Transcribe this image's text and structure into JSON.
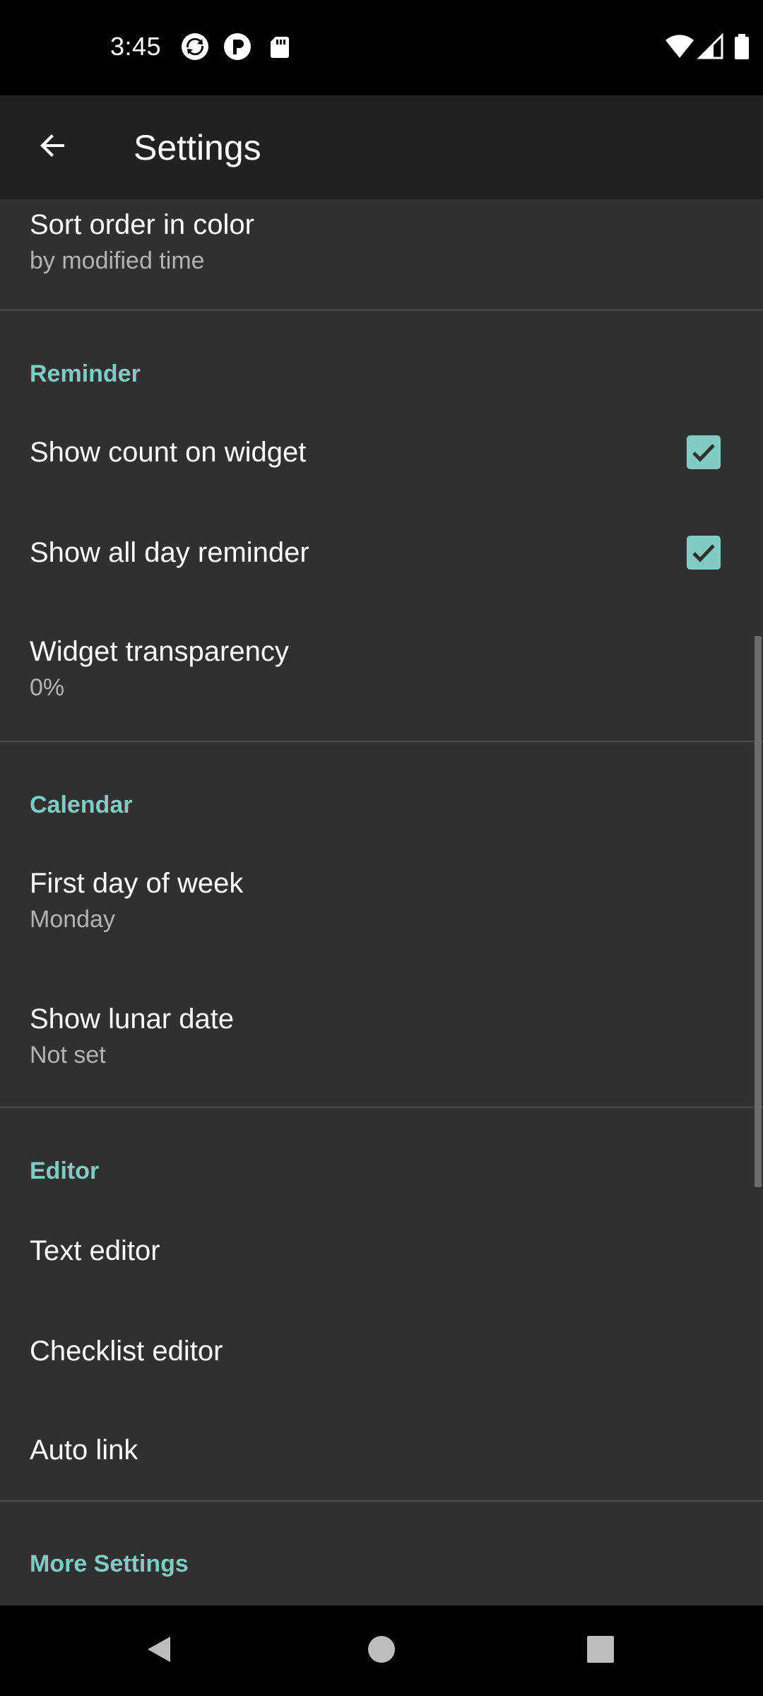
{
  "status_bar": {
    "time": "3:45",
    "left_icons": [
      "sync-icon",
      "p-badge-icon",
      "sd-card-icon"
    ],
    "right_icons": [
      "wifi-icon",
      "cell-signal-icon",
      "battery-icon"
    ]
  },
  "app_bar": {
    "title": "Settings",
    "back_icon": "arrow-back-icon"
  },
  "settings": {
    "sort_order": {
      "title": "Sort order in color",
      "summary": "by modified time"
    },
    "reminder": {
      "header": "Reminder",
      "show_count": {
        "title": "Show count on widget",
        "checked": true
      },
      "all_day": {
        "title": "Show all day reminder",
        "checked": true
      },
      "transparency": {
        "title": "Widget transparency",
        "summary": "0%"
      }
    },
    "calendar": {
      "header": "Calendar",
      "first_day": {
        "title": "First day of week",
        "summary": "Monday"
      },
      "lunar": {
        "title": "Show lunar date",
        "summary": "Not set"
      }
    },
    "editor": {
      "header": "Editor",
      "text_editor": {
        "title": "Text editor"
      },
      "checklist_editor": {
        "title": "Checklist editor"
      },
      "auto_link": {
        "title": "Auto link"
      }
    },
    "more": {
      "header": "More Settings"
    }
  },
  "colors": {
    "accent": "#80cbc4",
    "background": "#303030",
    "app_bar": "#212121"
  },
  "nav_bar": {
    "icons": [
      "nav-back-icon",
      "nav-home-icon",
      "nav-recents-icon"
    ]
  }
}
